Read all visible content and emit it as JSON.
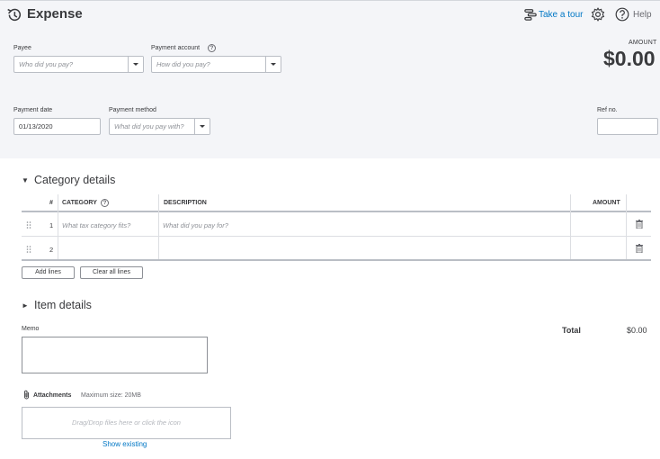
{
  "header": {
    "title": "Expense",
    "take_tour": "Take a tour",
    "help": "Help",
    "icons": [
      "history-icon",
      "tour-icon",
      "gear-icon",
      "help-icon"
    ]
  },
  "form": {
    "payee": {
      "label": "Payee",
      "placeholder": "Who did you pay?"
    },
    "payment_account": {
      "label": "Payment account",
      "placeholder": "How did you pay?"
    },
    "amount": {
      "label": "AMOUNT",
      "value": "$0.00"
    },
    "payment_date": {
      "label": "Payment date",
      "value": "01/13/2020"
    },
    "payment_method": {
      "label": "Payment method",
      "placeholder": "What did you pay with?"
    },
    "ref_no": {
      "label": "Ref no.",
      "value": ""
    }
  },
  "category_details": {
    "toggle": "▼",
    "title": "Category details",
    "columns": {
      "num": "#",
      "category": "CATEGORY",
      "description": "DESCRIPTION",
      "amount": "AMOUNT"
    },
    "rows": [
      {
        "num": "1",
        "category_placeholder": "What tax category fits?",
        "description_placeholder": "What did you pay for?"
      },
      {
        "num": "2",
        "category_placeholder": "",
        "description_placeholder": ""
      }
    ],
    "add_lines": "Add lines",
    "clear_all_lines": "Clear all lines"
  },
  "item_details": {
    "toggle": "►",
    "title": "Item details"
  },
  "memo": {
    "label": "Memo"
  },
  "total": {
    "label": "Total",
    "value": "$0.00"
  },
  "attachments": {
    "label": "Attachments",
    "max_size": "Maximum size: 20MB",
    "drop_text": "Drag/Drop files here or click the icon",
    "show_existing": "Show existing"
  },
  "colors": {
    "link": "#0077c5",
    "header_bg": "#f4f5f8",
    "text": "#393a3d"
  }
}
